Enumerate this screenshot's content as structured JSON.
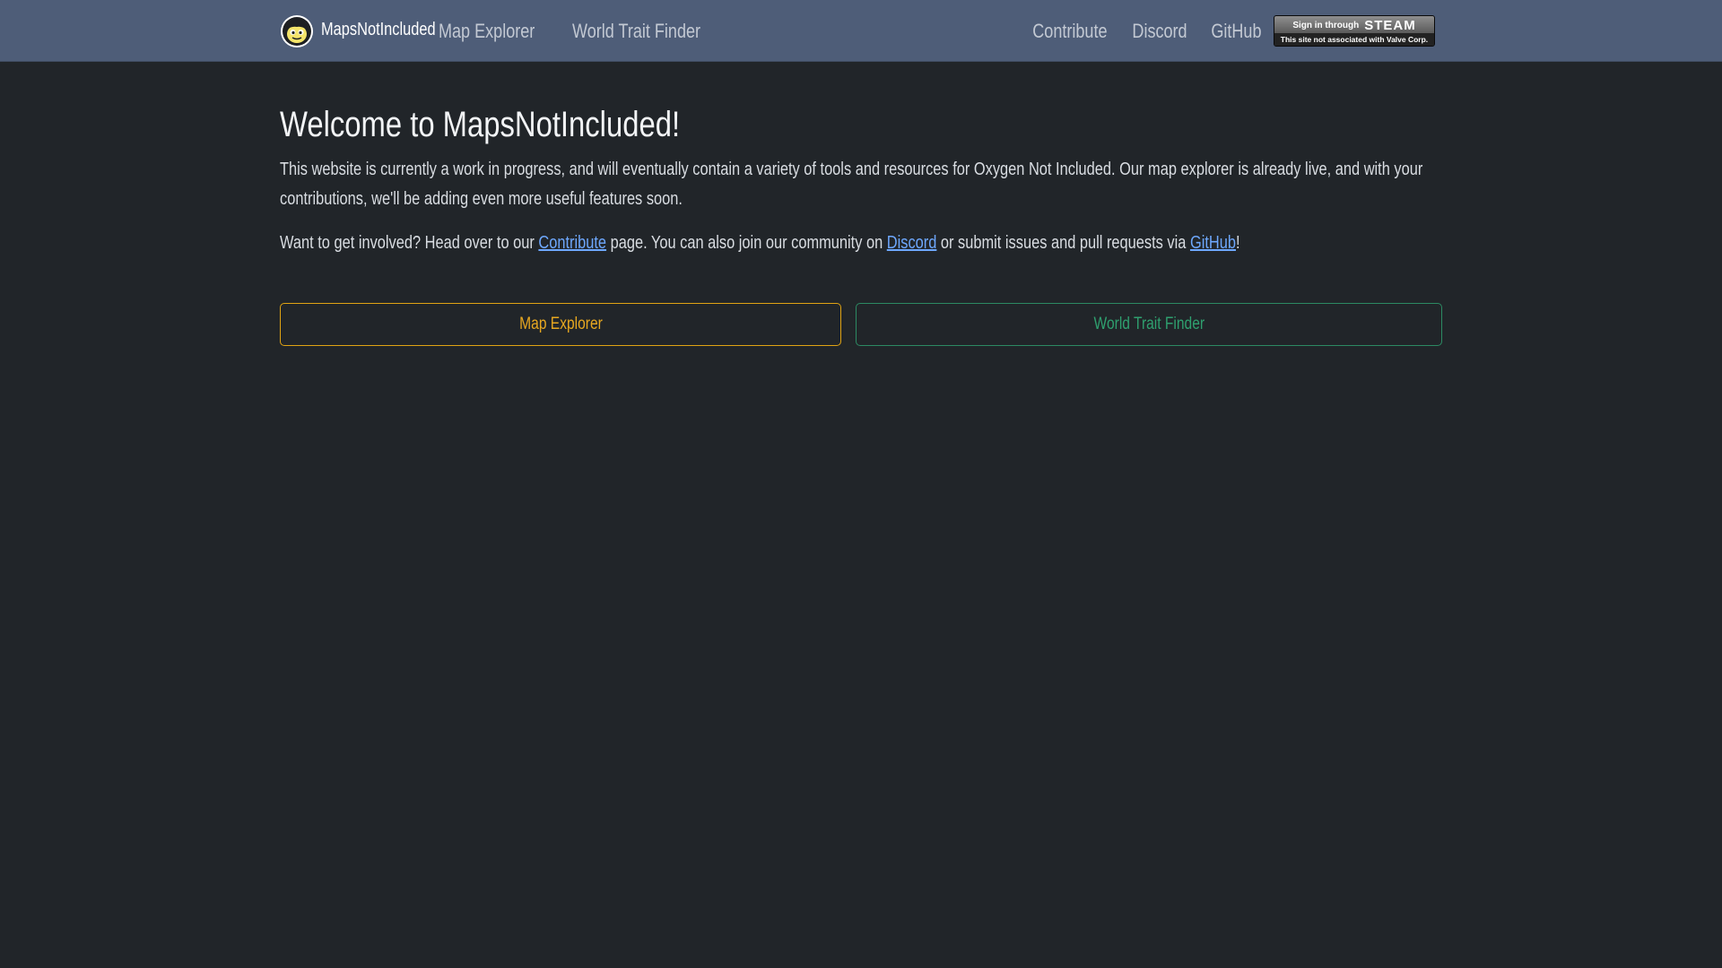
{
  "navbar": {
    "brand": "MapsNotIncluded",
    "left_links": [
      {
        "label": "Map Explorer"
      },
      {
        "label": "World Trait Finder"
      }
    ],
    "right_links": [
      {
        "label": "Contribute"
      },
      {
        "label": "Discord"
      },
      {
        "label": "GitHub"
      }
    ],
    "steam": {
      "sign_in_text": "Sign in through",
      "brand_text": "STEAM",
      "disclaimer": "This site not associated with Valve Corp."
    }
  },
  "main": {
    "title": "Welcome to MapsNotIncluded!",
    "intro": "This website is currently a work in progress, and will eventually contain a variety of tools and resources for Oxygen Not Included. Our map explorer is already live, and with your contributions, we'll be adding even more useful features soon.",
    "involve": {
      "text_1": "Want to get involved? Head over to our ",
      "link_contribute": "Contribute",
      "text_2": " page. You can also join our community on ",
      "link_discord": "Discord",
      "text_3": " or submit issues and pull requests via ",
      "link_github": "GitHub",
      "text_4": "!"
    },
    "buttons": {
      "map_explorer": "Map Explorer",
      "world_trait_finder": "World Trait Finder"
    }
  },
  "colors": {
    "navbar_bg": "#4e5d78",
    "page_bg": "#212529",
    "link": "#6ea8fe",
    "map_button": "#e0a313",
    "trait_button": "#2c8a63"
  },
  "icons": {
    "logo": "duplicant-face-icon"
  }
}
